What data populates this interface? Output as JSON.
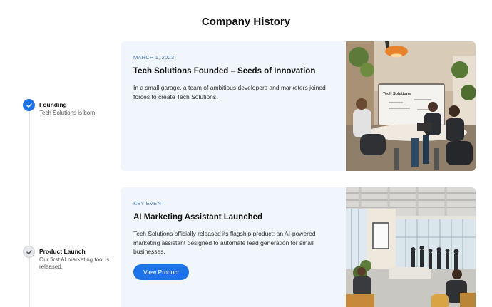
{
  "page": {
    "title": "Company History"
  },
  "timeline": [
    {
      "title": "Founding",
      "description": "Tech Solutions is born!",
      "state": "active"
    },
    {
      "title": "Product Launch",
      "description": "Our first AI marketing tool is released.",
      "state": "completed"
    }
  ],
  "events": [
    {
      "meta": "MARCH 1, 2023",
      "title": "Tech Solutions Founded – Seeds of Innovation",
      "description": "In a small garage, a team of ambitious developers and marketers joined forces to create Tech Solutions.",
      "image_icon": "team-meeting-photo",
      "image_text": "Tech Solutions"
    },
    {
      "meta": "KEY EVENT",
      "title": "AI Marketing Assistant Launched",
      "description": "Tech Solutions officially released its flagship product: an AI-powered marketing assistant designed to automate lead generation for small businesses.",
      "button_label": "View Product",
      "image_icon": "launch-event-photo"
    }
  ],
  "colors": {
    "accent": "#1e73e8",
    "card_bg": "#f1f6fd",
    "meta_text": "#4a78b0"
  }
}
